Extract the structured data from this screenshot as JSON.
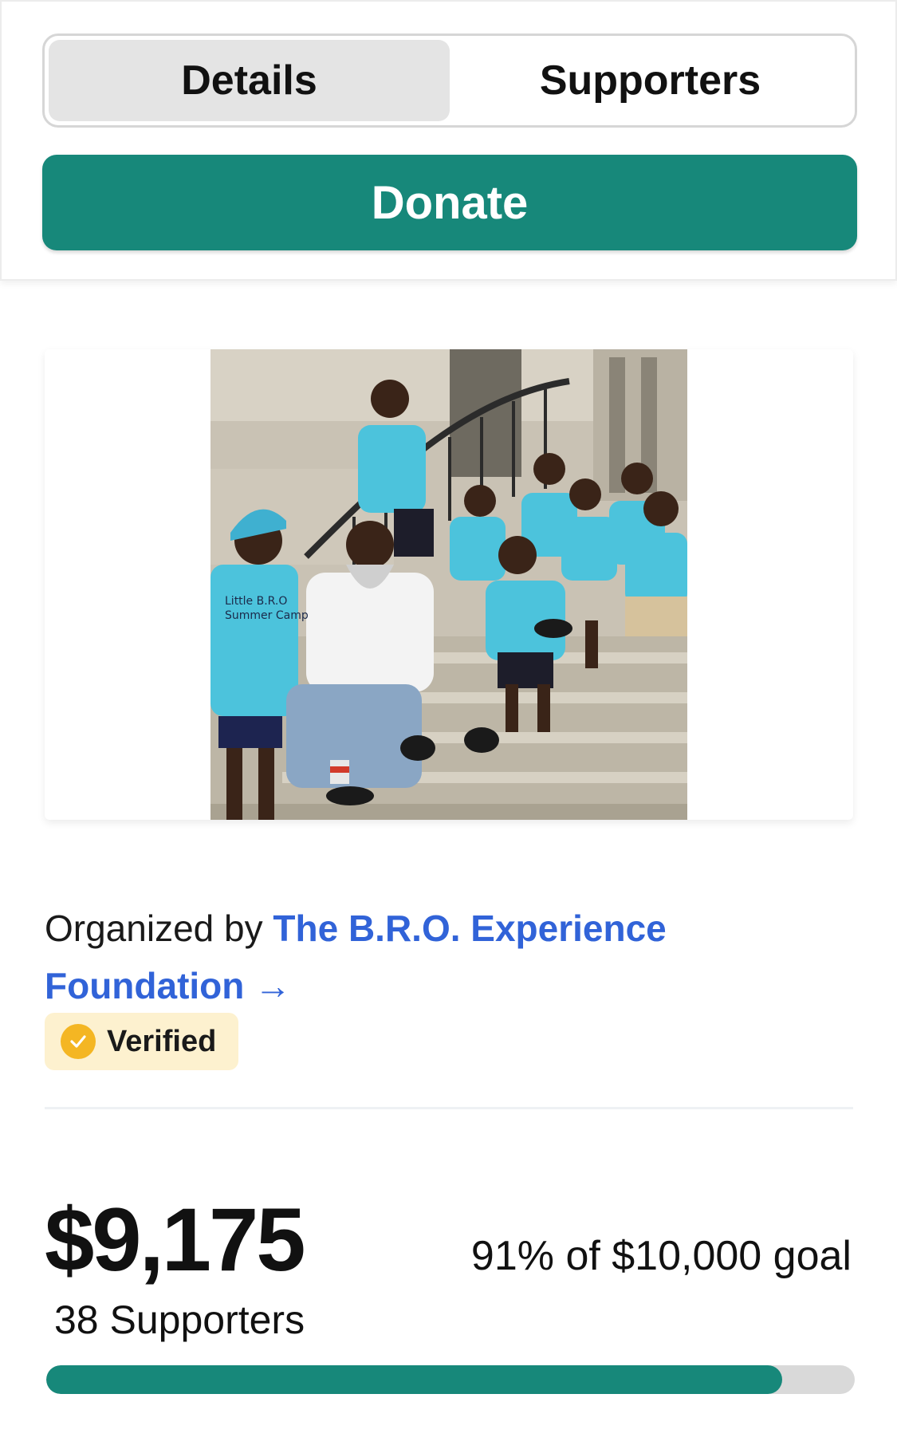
{
  "tabs": [
    {
      "label": "Details",
      "active": true
    },
    {
      "label": "Supporters",
      "active": false
    }
  ],
  "donate_label": "Donate",
  "organizer": {
    "prefix": "Organized by",
    "name": "The B.R.O. Experience Foundation",
    "arrow": "→",
    "badge": "Verified"
  },
  "fundraising": {
    "raised": "$9,175",
    "goal_text": "91% of $10,000 goal",
    "supporters_text": "38 Supporters",
    "progress_percent": 91
  },
  "colors": {
    "accent": "#17887a",
    "link": "#3163d8",
    "badge_bg": "#fdf1cf",
    "badge_icon": "#f4b623"
  },
  "photo": {
    "shirt_texts": [
      "Little B.R.O",
      "Summer Camp"
    ]
  }
}
